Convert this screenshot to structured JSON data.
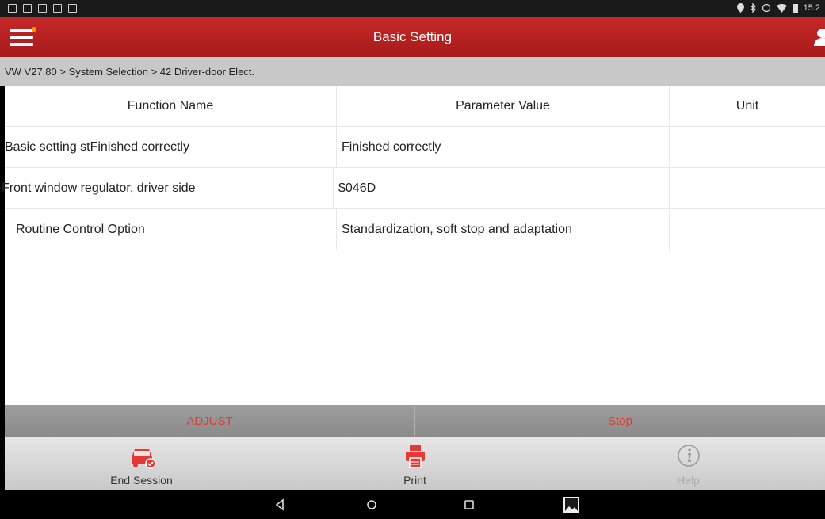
{
  "status_bar": {
    "time": "15:2"
  },
  "app_bar": {
    "title": "Basic Setting",
    "menu_icon": "hamburger-menu-icon",
    "user_icon": "user-icon",
    "notification_dot_color": "#ff9800"
  },
  "breadcrumb": {
    "text": "VW V27.80 > System Selection > 42 Driver-door Elect."
  },
  "table": {
    "headers": [
      "Function Name",
      "Parameter Value",
      "Unit"
    ],
    "rows": [
      {
        "name": "Basic setting stFinished correctly",
        "value": "Finished correctly",
        "unit": ""
      },
      {
        "name": "Front window regulator, driver side",
        "value": "$046D",
        "unit": ""
      },
      {
        "name": "Routine Control Option",
        "value": "Standardization, soft stop and adaptation",
        "unit": ""
      }
    ]
  },
  "actions": {
    "adjust_label": "ADJUST",
    "stop_label": "Stop",
    "accent_color": "#e53935"
  },
  "toolbar": {
    "end_session_label": "End Session",
    "print_label": "Print",
    "help_label": "Help",
    "end_session_icon": "car-check-icon",
    "print_icon": "printer-icon",
    "help_icon": "info-icon"
  },
  "theme": {
    "app_bar_color": "#b71c1c",
    "breadcrumb_bg": "#c8c8c8"
  }
}
